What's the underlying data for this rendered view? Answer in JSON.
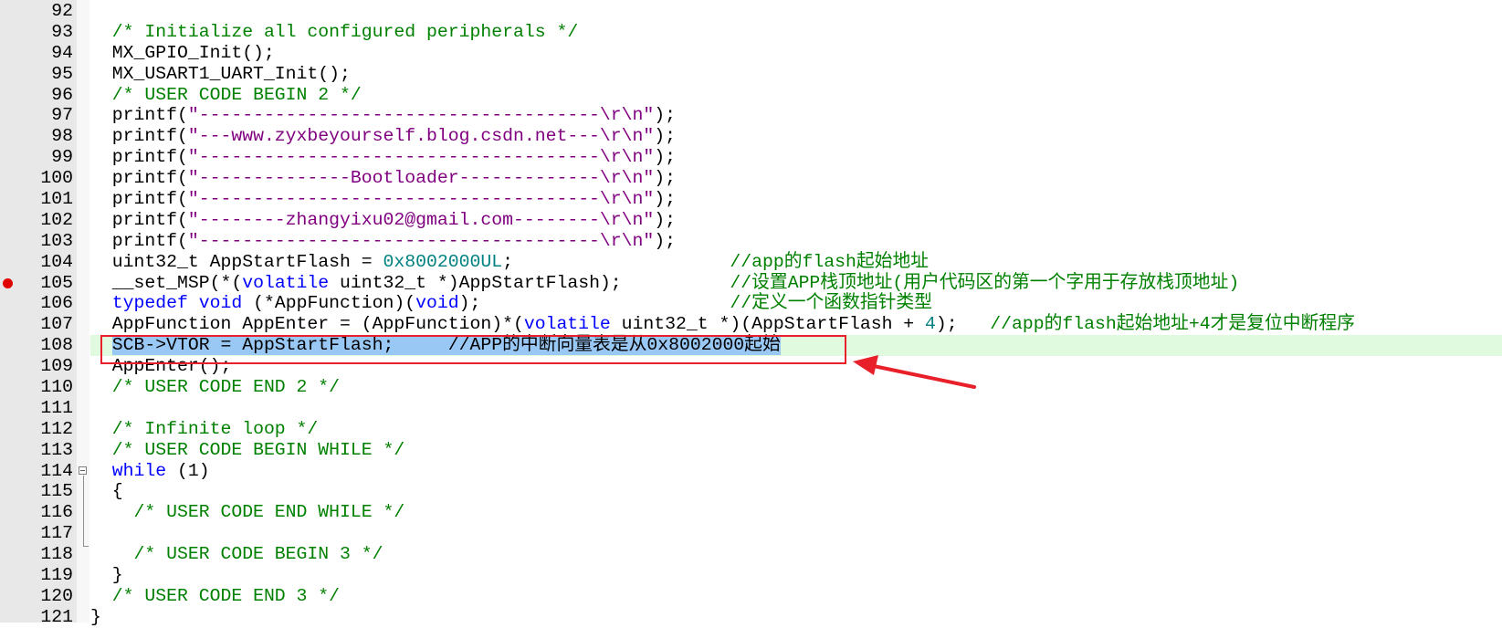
{
  "editor": {
    "highlight_color": "#e8202a",
    "current_line": 108,
    "breakpoint_line": 105,
    "lines": [
      {
        "n": "92",
        "t": []
      },
      {
        "n": "93",
        "t": [
          [
            "  ",
            ""
          ],
          [
            "/* Initialize all configured peripherals */",
            "cm"
          ]
        ]
      },
      {
        "n": "94",
        "t": [
          [
            "  MX_GPIO_Init();",
            ""
          ]
        ]
      },
      {
        "n": "95",
        "t": [
          [
            "  MX_USART1_UART_Init();",
            ""
          ]
        ]
      },
      {
        "n": "96",
        "t": [
          [
            "  ",
            ""
          ],
          [
            "/* USER CODE BEGIN 2 */",
            "cm"
          ]
        ]
      },
      {
        "n": "97",
        "t": [
          [
            "  printf(",
            ""
          ],
          [
            "\"-------------------------------------\\r\\n\"",
            "st"
          ],
          [
            ");",
            ""
          ]
        ]
      },
      {
        "n": "98",
        "t": [
          [
            "  printf(",
            ""
          ],
          [
            "\"---www.zyxbeyourself.blog.csdn.net---\\r\\n\"",
            "st"
          ],
          [
            ");",
            ""
          ]
        ]
      },
      {
        "n": "99",
        "t": [
          [
            "  printf(",
            ""
          ],
          [
            "\"-------------------------------------\\r\\n\"",
            "st"
          ],
          [
            ");",
            ""
          ]
        ]
      },
      {
        "n": "100",
        "t": [
          [
            "  printf(",
            ""
          ],
          [
            "\"--------------Bootloader-------------\\r\\n\"",
            "st"
          ],
          [
            ");",
            ""
          ]
        ]
      },
      {
        "n": "101",
        "t": [
          [
            "  printf(",
            ""
          ],
          [
            "\"-------------------------------------\\r\\n\"",
            "st"
          ],
          [
            ");",
            ""
          ]
        ]
      },
      {
        "n": "102",
        "t": [
          [
            "  printf(",
            ""
          ],
          [
            "\"--------zhangyixu02@gmail.com--------\\r\\n\"",
            "st"
          ],
          [
            ");",
            ""
          ]
        ]
      },
      {
        "n": "103",
        "t": [
          [
            "  printf(",
            ""
          ],
          [
            "\"-------------------------------------\\r\\n\"",
            "st"
          ],
          [
            ");",
            ""
          ]
        ]
      },
      {
        "n": "104",
        "t": [
          [
            "  uint32_t AppStartFlash = ",
            ""
          ],
          [
            "0x8002000UL",
            "nm"
          ],
          [
            ";                    ",
            ""
          ],
          [
            "//app的flash起始地址",
            "cm"
          ]
        ]
      },
      {
        "n": "105",
        "t": [
          [
            "  __set_MSP(*(",
            ""
          ],
          [
            "volatile",
            "kw"
          ],
          [
            " uint32_t *)AppStartFlash);          ",
            ""
          ],
          [
            "//设置APP栈顶地址(用户代码区的第一个字用于存放栈顶地址)",
            "cm"
          ]
        ]
      },
      {
        "n": "106",
        "t": [
          [
            "  ",
            ""
          ],
          [
            "typedef",
            "kw"
          ],
          [
            " ",
            ""
          ],
          [
            "void",
            "kw"
          ],
          [
            " (*AppFunction)(",
            ""
          ],
          [
            "void",
            "kw"
          ],
          [
            ");                       ",
            ""
          ],
          [
            "//定义一个函数指针类型",
            "cm"
          ]
        ]
      },
      {
        "n": "107",
        "t": [
          [
            "  AppFunction AppEnter = (AppFunction)*(",
            ""
          ],
          [
            "volatile",
            "kw"
          ],
          [
            " uint32_t *)(AppStartFlash + ",
            ""
          ],
          [
            "4",
            "nm"
          ],
          [
            ");   ",
            ""
          ],
          [
            "//app的flash起始地址+4才是复位中断程序",
            "cm"
          ]
        ]
      },
      {
        "n": "108",
        "t": [
          [
            "  ",
            ""
          ],
          [
            "SCB->VTOR = AppStartFlash;     //APP的中断向量表是从0x8002000起始",
            "sel"
          ]
        ]
      },
      {
        "n": "109",
        "t": [
          [
            "  AppEnter();",
            ""
          ]
        ]
      },
      {
        "n": "110",
        "t": [
          [
            "  ",
            ""
          ],
          [
            "/* USER CODE END 2 */",
            "cm"
          ]
        ]
      },
      {
        "n": "111",
        "t": []
      },
      {
        "n": "112",
        "t": [
          [
            "  ",
            ""
          ],
          [
            "/* Infinite loop */",
            "cm"
          ]
        ]
      },
      {
        "n": "113",
        "t": [
          [
            "  ",
            ""
          ],
          [
            "/* USER CODE BEGIN WHILE */",
            "cm"
          ]
        ]
      },
      {
        "n": "114",
        "t": [
          [
            "  ",
            ""
          ],
          [
            "while",
            "kw"
          ],
          [
            " (1)",
            ""
          ]
        ]
      },
      {
        "n": "115",
        "t": [
          [
            "  {",
            ""
          ]
        ]
      },
      {
        "n": "116",
        "t": [
          [
            "    ",
            ""
          ],
          [
            "/* USER CODE END WHILE */",
            "cm"
          ]
        ]
      },
      {
        "n": "117",
        "t": []
      },
      {
        "n": "118",
        "t": [
          [
            "    ",
            ""
          ],
          [
            "/* USER CODE BEGIN 3 */",
            "cm"
          ]
        ]
      },
      {
        "n": "119",
        "t": [
          [
            "  }",
            ""
          ]
        ]
      },
      {
        "n": "120",
        "t": [
          [
            "  ",
            ""
          ],
          [
            "/* USER CODE END 3 */",
            "cm"
          ]
        ]
      },
      {
        "n": "121",
        "t": [
          [
            "}",
            ""
          ]
        ]
      }
    ]
  }
}
